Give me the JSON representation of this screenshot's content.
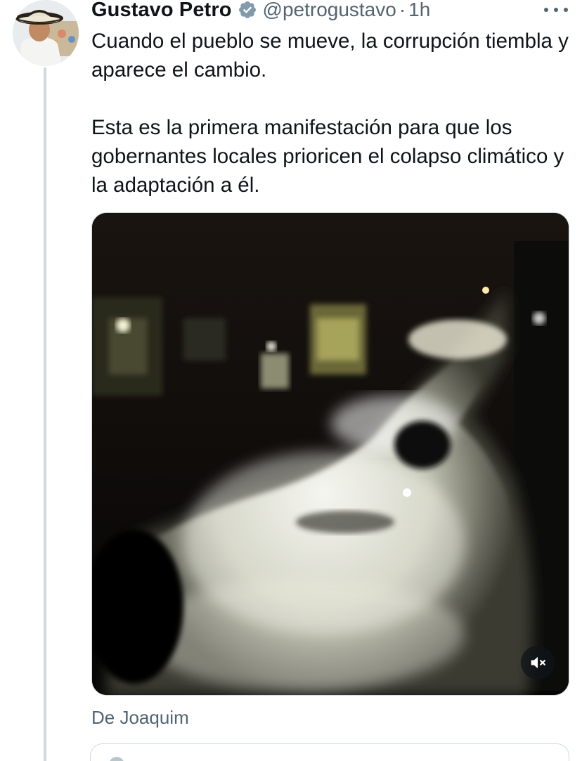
{
  "tweet": {
    "author_name": "Gustavo Petro",
    "handle": "@petrogustavo",
    "separator": "·",
    "time": "1h",
    "text_paragraphs": [
      "Cuando el pueblo se mueve, la corrupción tiembla y aparece el cambio.",
      "Esta es la primera manifestación para que los gobernantes locales prioricen el colapso climático y la adaptación a él."
    ],
    "source_label": "De Joaquim"
  },
  "icons": {
    "verified": "verified-badge-icon",
    "more": "more-options-icon",
    "mute": "volume-muted-icon"
  },
  "colors": {
    "text_primary": "#0f1419",
    "text_secondary": "#536471",
    "border": "#cfd9de",
    "verified_badge": "#829aab"
  }
}
